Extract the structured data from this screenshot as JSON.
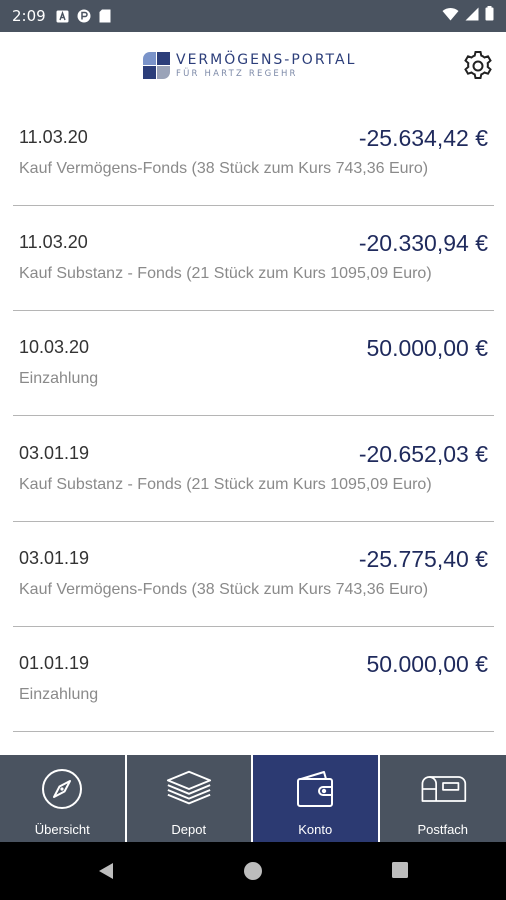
{
  "status_bar": {
    "time": "2:09",
    "left_icons": [
      "a-box-icon",
      "circle-p-icon",
      "sd-card-icon"
    ],
    "right_icons": [
      "wifi-icon",
      "signal-icon",
      "battery-icon"
    ]
  },
  "header": {
    "logo_title": "VERMÖGENS-PORTAL",
    "logo_subtitle": "FÜR HARTZ REGEHR",
    "settings_icon": "gear-icon"
  },
  "transactions": [
    {
      "date": "11.03.20",
      "amount": "-25.634,42 €",
      "description": "Kauf Vermögens-Fonds (38 Stück zum Kurs 743,36 Euro)"
    },
    {
      "date": "11.03.20",
      "amount": "-20.330,94 €",
      "description": "Kauf Substanz - Fonds (21 Stück zum Kurs 1095,09 Euro)"
    },
    {
      "date": "10.03.20",
      "amount": "50.000,00 €",
      "description": "Einzahlung"
    },
    {
      "date": "03.01.19",
      "amount": "-20.652,03 €",
      "description": "Kauf Substanz - Fonds (21 Stück zum Kurs 1095,09 Euro)"
    },
    {
      "date": "03.01.19",
      "amount": "-25.775,40 €",
      "description": "Kauf Vermögens-Fonds (38 Stück zum Kurs 743,36 Euro)"
    },
    {
      "date": "01.01.19",
      "amount": "50.000,00 €",
      "description": "Einzahlung"
    }
  ],
  "bottom_nav": [
    {
      "label": "Übersicht",
      "icon": "compass-icon",
      "active": false
    },
    {
      "label": "Depot",
      "icon": "layers-icon",
      "active": false
    },
    {
      "label": "Konto",
      "icon": "wallet-icon",
      "active": true
    },
    {
      "label": "Postfach",
      "icon": "mailbox-icon",
      "active": false
    }
  ],
  "colors": {
    "bar_background": "#4a5360",
    "active_tab": "#2c3a72",
    "amount_text": "#1f2a5c",
    "logo_text": "#2c3e7a"
  }
}
